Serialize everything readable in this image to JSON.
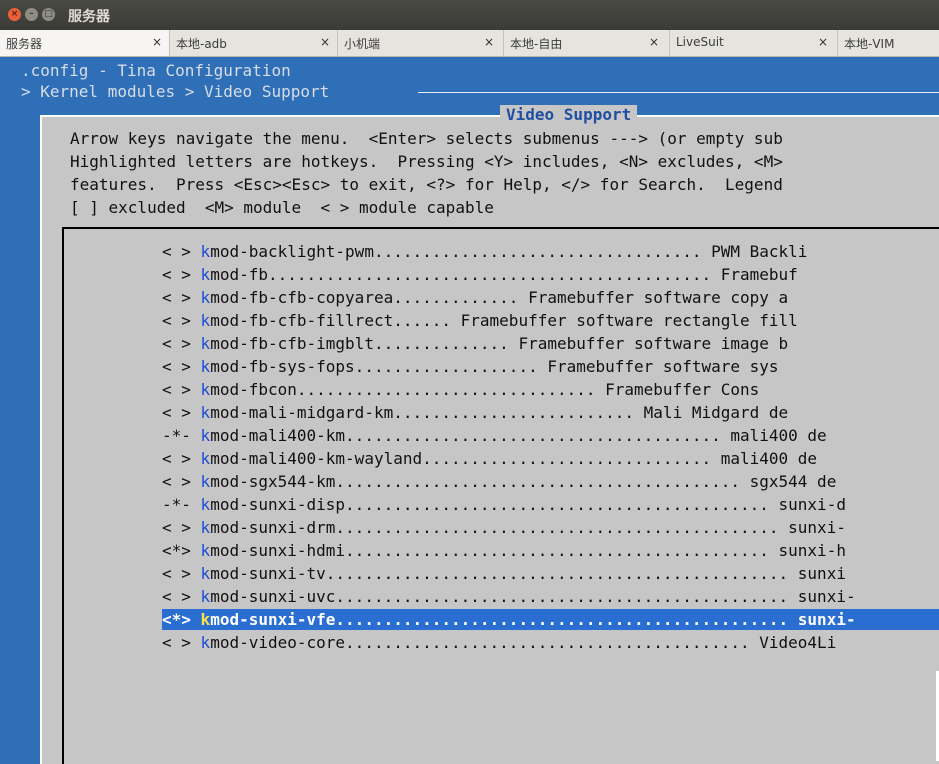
{
  "window": {
    "title": "服务器"
  },
  "tabs": [
    {
      "label": "服务器",
      "close": "×",
      "active": true
    },
    {
      "label": "本地-adb",
      "close": "×",
      "active": false
    },
    {
      "label": "小机端",
      "close": "×",
      "active": false
    },
    {
      "label": "本地-自由",
      "close": "×",
      "active": false
    },
    {
      "label": "LiveSuit",
      "close": "×",
      "active": false
    },
    {
      "label": "本地-VIM",
      "close": "",
      "active": false
    }
  ],
  "terminal": {
    "header_line1": ".config - Tina Configuration",
    "header_line2": "> Kernel modules > Video Support "
  },
  "dialog": {
    "title": "Video Support",
    "help_lines": [
      "Arrow keys navigate the menu.  <Enter> selects submenus ---> (or empty sub",
      "Highlighted letters are hotkeys.  Pressing <Y> includes, <N> excludes, <M>",
      "features.  Press <Esc><Esc> to exit, <?> for Help, </> for Search.  Legend",
      "[ ] excluded  <M> module  < > module capable"
    ]
  },
  "menu": {
    "items": [
      {
        "state": "< >",
        "hotkey": "k",
        "rest": "mod-backlight-pwm.................................. PWM Backli",
        "selected": false
      },
      {
        "state": "< >",
        "hotkey": "k",
        "rest": "mod-fb.............................................. Framebuf",
        "selected": false
      },
      {
        "state": "< >",
        "hotkey": "k",
        "rest": "mod-fb-cfb-copyarea............. Framebuffer software copy a",
        "selected": false
      },
      {
        "state": "< >",
        "hotkey": "k",
        "rest": "mod-fb-cfb-fillrect...... Framebuffer software rectangle fill",
        "selected": false
      },
      {
        "state": "< >",
        "hotkey": "k",
        "rest": "mod-fb-cfb-imgblt.............. Framebuffer software image b",
        "selected": false
      },
      {
        "state": "< >",
        "hotkey": "k",
        "rest": "mod-fb-sys-fops................... Framebuffer software sys",
        "selected": false
      },
      {
        "state": "< >",
        "hotkey": "k",
        "rest": "mod-fbcon............................... Framebuffer Cons",
        "selected": false
      },
      {
        "state": "< >",
        "hotkey": "k",
        "rest": "mod-mali-midgard-km......................... Mali Midgard de",
        "selected": false
      },
      {
        "state": "-*-",
        "hotkey": "k",
        "rest": "mod-mali400-km....................................... mali400 de",
        "selected": false
      },
      {
        "state": "< >",
        "hotkey": "k",
        "rest": "mod-mali400-km-wayland.............................. mali400 de",
        "selected": false
      },
      {
        "state": "< >",
        "hotkey": "k",
        "rest": "mod-sgx544-km.......................................... sgx544 de",
        "selected": false
      },
      {
        "state": "-*-",
        "hotkey": "k",
        "rest": "mod-sunxi-disp............................................ sunxi-d",
        "selected": false
      },
      {
        "state": "< >",
        "hotkey": "k",
        "rest": "mod-sunxi-drm.............................................. sunxi-",
        "selected": false
      },
      {
        "state": "<*>",
        "hotkey": "k",
        "rest": "mod-sunxi-hdmi............................................ sunxi-h",
        "selected": false
      },
      {
        "state": "< >",
        "hotkey": "k",
        "rest": "mod-sunxi-tv................................................ sunxi",
        "selected": false
      },
      {
        "state": "< >",
        "hotkey": "k",
        "rest": "mod-sunxi-uvc............................................... sunxi-",
        "selected": false
      },
      {
        "state": "<*>",
        "hotkey": "k",
        "rest": "mod-sunxi-vfe............................................... sunxi-",
        "selected": true
      },
      {
        "state": "< >",
        "hotkey": "k",
        "rest": "mod-video-core.......................................... Video4Li",
        "selected": false
      }
    ]
  },
  "colors": {
    "terminal_bg": "#2e6fb8",
    "dialog_bg": "#c6c6c6",
    "title_fg": "#1e4fa0",
    "hotkey": "#1b4fd6",
    "selection_bg": "#2a6ed2",
    "selection_hotkey": "#ffe24a"
  }
}
